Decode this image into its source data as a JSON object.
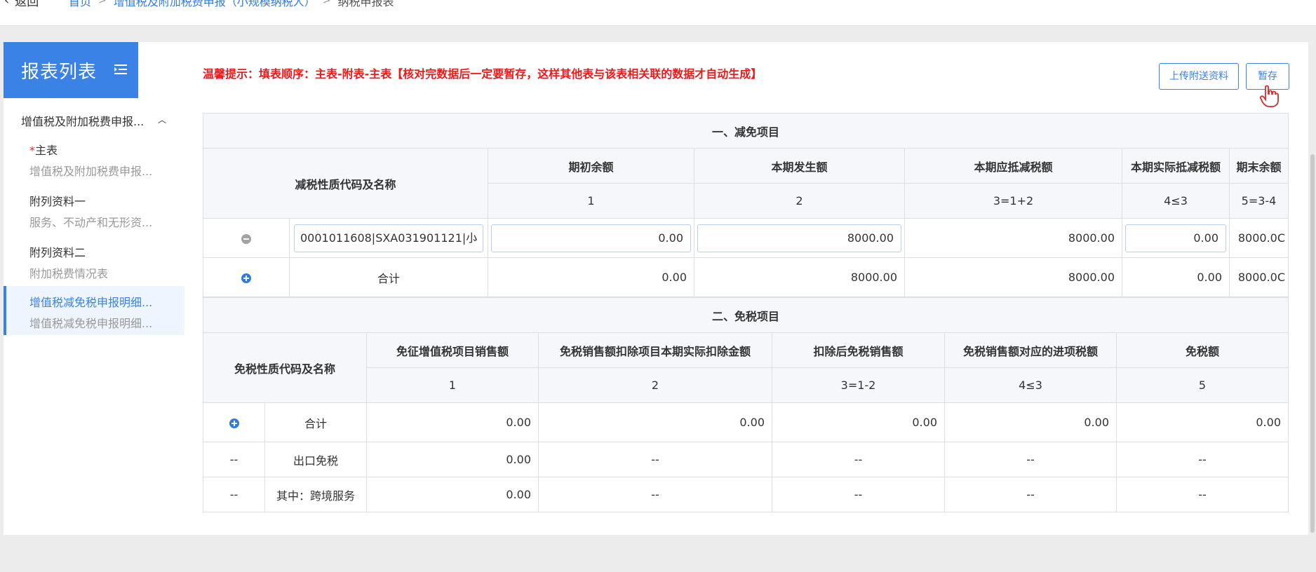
{
  "topbar": {
    "back_label": "返回",
    "breadcrumbs": [
      "首页",
      "增值税及附加税费申报（小规模纳税人）",
      "纳税申报表"
    ]
  },
  "sidebar": {
    "title": "报表列表",
    "group_title": "增值税及附加税费申报...",
    "items": [
      {
        "required_mark": "*",
        "label": "主表",
        "sub": "增值税及附加税费申报..."
      },
      {
        "label": "附列资料一",
        "sub": "服务、不动产和无形资..."
      },
      {
        "label": "附列资料二",
        "sub": "附加税费情况表"
      },
      {
        "label": "增值税减免税申报明细...",
        "sub": "增值税减免税申报明细..."
      }
    ]
  },
  "warning": "温馨提示：填表顺序：主表-附表-主表【核对完数据后一定要暂存，这样其他表与该表相关联的数据才自动生成】",
  "buttons": {
    "upload": "上传附送资料",
    "save": "暂存"
  },
  "section1": {
    "title": "一、减免项目",
    "code_header": "减税性质代码及名称",
    "columns": [
      "期初余额",
      "本期发生额",
      "本期应抵减税额",
      "本期实际抵减税额",
      "期末余额"
    ],
    "column_nos": [
      "1",
      "2",
      "3=1+2",
      "4≤3",
      "5=3-4"
    ],
    "row": {
      "select_value": "0001011608|SXA031901121|小",
      "opening": "0.00",
      "current": "8000.00",
      "deductible": "8000.00",
      "actual": "0.00",
      "closing": "8000.0C"
    },
    "total": {
      "label": "合计",
      "values": [
        "0.00",
        "8000.00",
        "8000.00",
        "0.00",
        "8000.0C"
      ]
    }
  },
  "section2": {
    "title": "二、免税项目",
    "code_header": "免税性质代码及名称",
    "columns": [
      "免征增值税项目销售额",
      "免税销售额扣除项目本期实际扣除金额",
      "扣除后免税销售额",
      "免税销售额对应的进项税额",
      "免税额"
    ],
    "column_nos": [
      "1",
      "2",
      "3=1-2",
      "4≤3",
      "5"
    ],
    "rows": [
      {
        "mark": "",
        "label": "合计",
        "values": [
          "0.00",
          "0.00",
          "0.00",
          "0.00",
          "0.00"
        ]
      },
      {
        "mark": "--",
        "label": "出口免税",
        "values": [
          "0.00",
          "--",
          "--",
          "--",
          "--"
        ]
      },
      {
        "mark": "--",
        "label": "其中：跨境服务",
        "values": [
          "0.00",
          "--",
          "--",
          "--",
          "--"
        ]
      }
    ]
  },
  "colors": {
    "accent": "#3b82e6",
    "warning": "#f01818"
  }
}
